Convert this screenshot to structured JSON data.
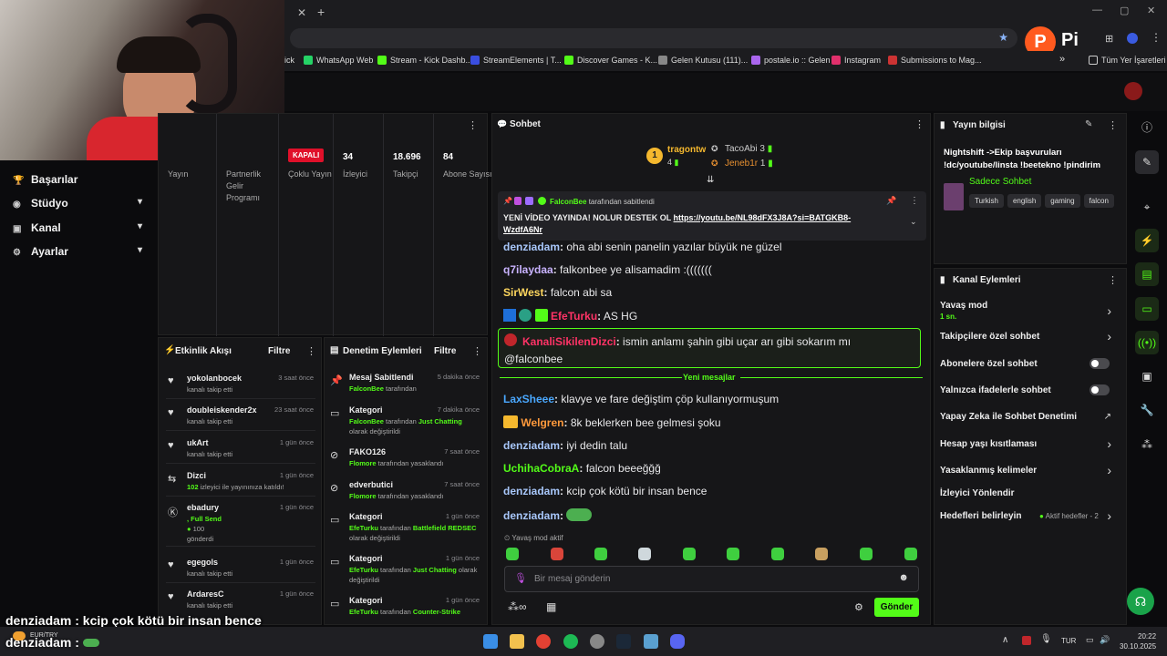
{
  "browser": {
    "bookmarks": [
      "ick",
      "WhatsApp Web",
      "Stream - Kick Dashb...",
      "StreamElements | T...",
      "Discover Games - K...",
      "Gelen Kutusu (111)...",
      "postale.io :: Gelen",
      "Instagram",
      "Submissions to Mag..."
    ],
    "bookmarks_more": "»",
    "all_bookmarks": "Tüm Yer İşaretleri",
    "profile_letter": "P"
  },
  "left_nav": {
    "items": [
      {
        "label": "Başarılar",
        "icon": "trophy-icon"
      },
      {
        "label": "Stüdyo",
        "icon": "studio-icon"
      },
      {
        "label": "Kanal",
        "icon": "channel-icon"
      },
      {
        "label": "Ayarlar",
        "icon": "gear-icon"
      }
    ]
  },
  "stats": {
    "kapali": "KAPALI",
    "items": [
      {
        "value": "",
        "label": "Yayın"
      },
      {
        "value": "",
        "label": "Partnerlik Gelir Programı"
      },
      {
        "value": "",
        "label": "Çoklu Yayın"
      },
      {
        "value": "34",
        "label": "İzleyici"
      },
      {
        "value": "18.696",
        "label": "Takipçi"
      },
      {
        "value": "84",
        "label": "Abone Sayısı"
      }
    ]
  },
  "activity": {
    "title": "Etkinlik Akışı",
    "filter": "Filtre",
    "items": [
      {
        "name": "yokolanbocek",
        "sub": "kanalı takip etti",
        "time": "3 saat önce",
        "icon": "heart-icon"
      },
      {
        "name": "doubleiskender2x",
        "sub": "kanalı takip etti",
        "time": "23 saat önce",
        "icon": "heart-icon"
      },
      {
        "name": "ukArt",
        "sub": "kanalı takip etti",
        "time": "1 gün önce",
        "icon": "heart-icon"
      },
      {
        "name": "Dizci",
        "sub_green": "102",
        "sub": " izleyici ile yayınınıza katıldı!",
        "time": "1 gün önce",
        "icon": "raid-icon"
      },
      {
        "name": "ebadury",
        "sub_green": ", Full Send",
        "sub2": "100",
        "sub3": "gönderdi",
        "time": "1 gün önce",
        "icon": "kick-icon"
      },
      {
        "name": "egegols",
        "sub": "kanalı takip etti",
        "time": "1 gün önce",
        "icon": "heart-icon"
      },
      {
        "name": "ArdaresC",
        "sub": "kanalı takip etti",
        "time": "1 gün önce",
        "icon": "heart-icon"
      }
    ]
  },
  "moderation": {
    "title": "Denetim Eylemleri",
    "filter": "Filtre",
    "items": [
      {
        "name": "Mesaj Sabitlendi",
        "user": "FalconBee",
        "sub": " tarafından",
        "extra": "",
        "extra2": "",
        "time": "5 dakika önce",
        "icon": "pin-icon"
      },
      {
        "name": "Kategori",
        "user": "FalconBee",
        "sub": " tarafından ",
        "extra": "Just Chatting",
        "extra2": "olarak değiştirildi",
        "time": "7 dakika önce",
        "icon": "category-icon"
      },
      {
        "name": "FAKO126",
        "user": "Flomore",
        "sub": " tarafından yasaklandı",
        "extra": "",
        "extra2": "",
        "time": "7 saat önce",
        "icon": "ban-icon"
      },
      {
        "name": "edverbutici",
        "user": "Flomore",
        "sub": " tarafından yasaklandı",
        "extra": "",
        "extra2": "",
        "time": "7 saat önce",
        "icon": "ban-icon"
      },
      {
        "name": "Kategori",
        "user": "EfeTurku",
        "sub": " tarafından ",
        "extra": "Battlefield REDSEC",
        "extra2": " olarak değiştirildi",
        "time": "1 gün önce",
        "icon": "category-icon"
      },
      {
        "name": "Kategori",
        "user": "EfeTurku",
        "sub": " tarafından ",
        "extra": "Just Chatting",
        "extra2": "olarak değiştirildi",
        "time": "1 gün önce",
        "icon": "category-icon"
      },
      {
        "name": "Kategori",
        "user": "EfeTurku",
        "sub": " tarafından ",
        "extra": "Counter-Strike",
        "extra2": "",
        "time": "1 gün önce",
        "icon": "category-icon"
      }
    ]
  },
  "chat": {
    "title": "Sohbet",
    "top_gifters": [
      {
        "name": "tragontw",
        "count": "4"
      },
      {
        "name": "TacoAbi",
        "count": "3"
      },
      {
        "name": "Jeneb1r",
        "count": "1"
      }
    ],
    "pinned": {
      "by_user": "FalconBee",
      "by_text": "tarafından sabitlendi",
      "text": "YENİ VİDEO YAYINDA! NOLUR DESTEK OL ",
      "link": "https://youtu.be/NL98dFX3J8A?si=BATGKB8-WzdfA6Nr"
    },
    "messages": [
      {
        "user": "denziadam",
        "text": "oha abi senin panelin yazılar büyük ne güzel",
        "color": "#a8c7fa"
      },
      {
        "user": "q7ilaydaa",
        "text": "falkonbee ye alisamadim :(((((((",
        "color": "#c9b3ff"
      },
      {
        "user": "SirWest",
        "text": "falcon abi sa",
        "color": "#ffd75e"
      },
      {
        "user": "EfeTurku",
        "text": "AS HG",
        "color": "#ff3366"
      }
    ],
    "highlight": {
      "user": "KanaliSikilenDizci",
      "text": "ismin anlamı şahin gibi uçar arı gibi sokarım mı @falconbee"
    },
    "new_messages": "Yeni mesajlar",
    "messages2": [
      {
        "user": "LaxSheee",
        "text": "klavye ve fare değiştim çöp kullanıyormuşum",
        "color": "#4aa8ff"
      },
      {
        "user": "Welgren",
        "text": "8k beklerken bee gelmesi şoku",
        "color": "#ff9a3c"
      },
      {
        "user": "denziadam",
        "text": "iyi dedin talu",
        "color": "#a8c7fa"
      },
      {
        "user": "UchihaCobraA",
        "text": "falcon beeeğğğ",
        "color": "#53fc18"
      },
      {
        "user": "denziadam",
        "text": "kcip çok kötü bir insan bence",
        "color": "#a8c7fa"
      },
      {
        "user": "denziadam",
        "text": "",
        "color": "#a8c7fa"
      }
    ],
    "slow_mode": "Yavaş mod aktif",
    "input_placeholder": "Bir mesaj gönderin",
    "send": "Gönder"
  },
  "stream_info": {
    "title": "Yayın bilgisi",
    "stream_title": "Nightshift ->Ekip başvuruları !dc/youtube/linsta !beetekno !pindirim",
    "category": "Sadece Sohbet",
    "tags": [
      "Turkish",
      "english",
      "gaming",
      "falcon"
    ]
  },
  "channel_actions": {
    "title": "Kanal Eylemleri",
    "items": [
      {
        "label": "Yavaş mod",
        "sub": "1 sn.",
        "control": "chevron"
      },
      {
        "label": "Takipçilere özel sohbet",
        "sub": "",
        "control": "chevron"
      },
      {
        "label": "Abonelere özel sohbet",
        "sub": "",
        "control": "toggle"
      },
      {
        "label": "Yalnızca ifadelerle sohbet",
        "sub": "",
        "control": "toggle"
      },
      {
        "label": "Yapay Zeka ile Sohbet Denetimi",
        "sub": "",
        "control": "external"
      },
      {
        "label": "Hesap yaşı kısıtlaması",
        "sub": "",
        "control": "chevron"
      },
      {
        "label": "Yasaklanmış kelimeler",
        "sub": "",
        "control": "chevron"
      },
      {
        "label": "İzleyici Yönlendir",
        "sub": "",
        "control": "none"
      },
      {
        "label": "Hedefleri belirleyin",
        "sub": "",
        "control": "goals"
      }
    ],
    "goals_status": "Aktif hedefler - 2"
  },
  "overlay": {
    "line1": "denziadam : kcip çok kötü bir insan bence",
    "line2": "denziadam :",
    "currency": "EUR/TRY"
  },
  "taskbar": {
    "lang": "TUR",
    "time": "20:22",
    "date": "30.10.2025"
  },
  "colors": {
    "accent": "#53fc18",
    "panel": "#161618",
    "bg": "#0b0b0d"
  }
}
